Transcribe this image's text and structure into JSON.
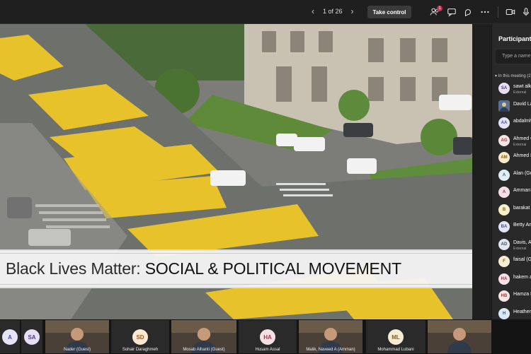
{
  "toolbar": {
    "slide_counter": "1 of 26",
    "take_control": "Take control",
    "notification_count": "1",
    "icons": [
      "people-icon",
      "chat-icon",
      "reactions-icon",
      "more-icon",
      "camera-icon",
      "mic-icon"
    ]
  },
  "slide": {
    "caption_normal": "Black Lives Matter: ",
    "caption_strong": "SOCIAL & POLITICAL MOVEMENT"
  },
  "participants_panel": {
    "title": "Participants",
    "search_placeholder": "Type a name",
    "section": "In this meeting (2",
    "people": [
      {
        "initials": "SA",
        "name": "sawt alkh",
        "sub": "External",
        "color": "#e7e0f5",
        "text": "#4b3b8a"
      },
      {
        "initials": "",
        "name": "David La",
        "sub": "",
        "color": "#5b6e8a",
        "text": "#fff",
        "photo": true
      },
      {
        "initials": "AA",
        "name": "abdalmh",
        "sub": "",
        "color": "#e6e4f7",
        "text": "#4f4aa3"
      },
      {
        "initials": "AG",
        "name": "Ahmed G",
        "sub": "External",
        "color": "#f7e4e4",
        "text": "#a33a3a"
      },
      {
        "initials": "AM",
        "name": "Ahmed M",
        "sub": "",
        "color": "#fbeac9",
        "text": "#8a5a13"
      },
      {
        "initials": "A",
        "name": "Alan (Gu",
        "sub": "",
        "color": "#dfeef8",
        "text": "#2d6a94"
      },
      {
        "initials": "A",
        "name": "Amman",
        "sub": "",
        "color": "#f6dfe6",
        "text": "#a0365a"
      },
      {
        "initials": "B",
        "name": "barakat",
        "sub": "",
        "color": "#fbeec9",
        "text": "#8a6813"
      },
      {
        "initials": "BA",
        "name": "Betty Am",
        "sub": "",
        "color": "#e4e5f7",
        "text": "#464aa0"
      },
      {
        "initials": "AD",
        "name": "Davis, Al",
        "sub": "External",
        "color": "#e2e7f0",
        "text": "#3d4f6e"
      },
      {
        "initials": "F",
        "name": "faisal (Gu",
        "sub": "",
        "color": "#f7eed5",
        "text": "#7a6321"
      },
      {
        "initials": "HA",
        "name": "hakem a",
        "sub": "",
        "color": "#f7e0e5",
        "text": "#a33650"
      },
      {
        "initials": "HB",
        "name": "Hamza B",
        "sub": "",
        "color": "#f7e4e4",
        "text": "#a33a3a"
      },
      {
        "initials": "H",
        "name": "Heather",
        "sub": "",
        "color": "#ddeaf6",
        "text": "#2d5e94"
      },
      {
        "initials": "HA",
        "name": "Husam A",
        "sub": "",
        "color": "#f7e0e5",
        "text": "#a33650"
      }
    ]
  },
  "gallery": [
    {
      "initials": "A",
      "name": "",
      "color": "#e6e4f7",
      "text": "#4f4aa3",
      "video": false
    },
    {
      "initials": "SA",
      "name": "",
      "color": "#e7e0f5",
      "text": "#4b3b8a",
      "video": false
    },
    {
      "initials": "",
      "name": "Nader (Guest)",
      "video": true
    },
    {
      "initials": "SD",
      "name": "Sohair Daraghmeh",
      "color": "#fbe9d3",
      "text": "#9a5b1c",
      "video": false
    },
    {
      "initials": "",
      "name": "Mosab Alhanti (Guest)",
      "video": true
    },
    {
      "initials": "HA",
      "name": "Husam Assal",
      "color": "#f7e0e5",
      "text": "#a33650",
      "video": false
    },
    {
      "initials": "",
      "name": "Malik, Naveed A (Amman)",
      "video": true
    },
    {
      "initials": "ML",
      "name": "Mohammad Lubani",
      "color": "#f5ecd3",
      "text": "#7a6321",
      "video": false
    },
    {
      "initials": "",
      "name": "",
      "video": true
    }
  ]
}
